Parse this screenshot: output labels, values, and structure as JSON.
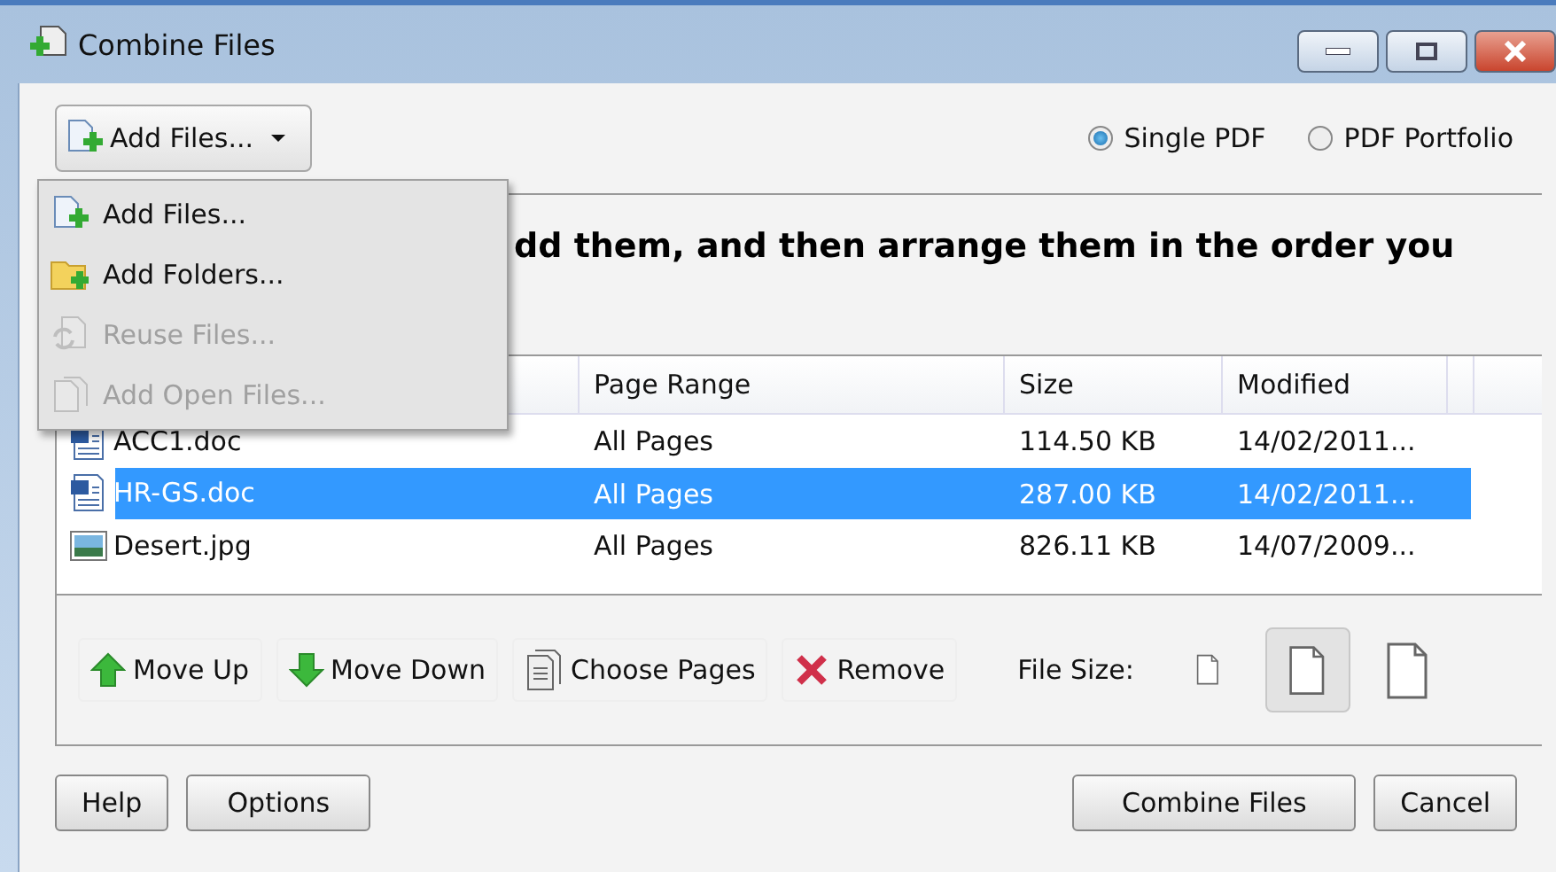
{
  "window": {
    "title": "Combine Files"
  },
  "add_files_button": {
    "label": "Add Files..."
  },
  "output_options": [
    {
      "label": "Single PDF",
      "selected": true
    },
    {
      "label": "PDF Portfolio",
      "selected": false
    }
  ],
  "add_menu": [
    {
      "label": "Add Files...",
      "kind": "file",
      "disabled": false
    },
    {
      "label": "Add Folders...",
      "kind": "folder",
      "disabled": false
    },
    {
      "label": "Reuse Files...",
      "kind": "reuse",
      "disabled": true
    },
    {
      "label": "Add Open Files...",
      "kind": "open",
      "disabled": true
    }
  ],
  "instruction": "dd them, and then arrange them in the order you",
  "table": {
    "columns": [
      "Page Range",
      "Size",
      "Modified"
    ],
    "rows": [
      {
        "name": "ACC1.doc",
        "kind": "doc",
        "page_range": "All Pages",
        "size": "114.50 KB",
        "modified": "14/02/2011...",
        "selected": false
      },
      {
        "name": "HR-GS.doc",
        "kind": "doc",
        "page_range": "All Pages",
        "size": "287.00 KB",
        "modified": "14/02/2011...",
        "selected": true
      },
      {
        "name": "Desert.jpg",
        "kind": "image",
        "page_range": "All Pages",
        "size": "826.11 KB",
        "modified": "14/07/2009...",
        "selected": false
      }
    ]
  },
  "toolbar": [
    {
      "label": "Move Up",
      "kind": "up"
    },
    {
      "label": "Move Down",
      "kind": "down"
    },
    {
      "label": "Choose Pages",
      "kind": "pages"
    },
    {
      "label": "Remove",
      "kind": "remove"
    }
  ],
  "file_size": {
    "label": "File Size:",
    "options": [
      {
        "kind": "small",
        "selected": false
      },
      {
        "kind": "medium",
        "selected": true
      },
      {
        "kind": "large",
        "selected": false
      }
    ]
  },
  "footer_left": [
    "Help",
    "Options"
  ],
  "footer_right": [
    "Combine Files",
    "Cancel"
  ]
}
